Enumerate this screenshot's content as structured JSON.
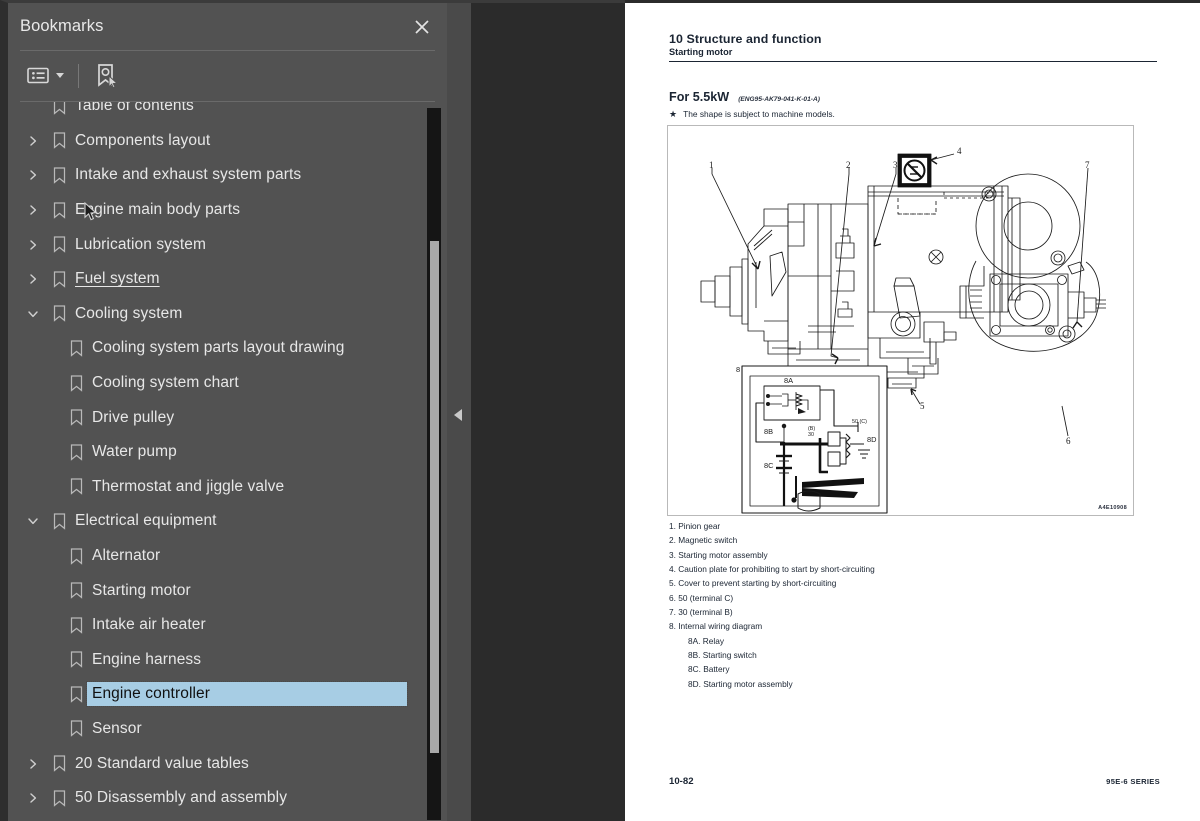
{
  "panel": {
    "title": "Bookmarks",
    "close_icon": "close-icon",
    "toolbar": {
      "options_icon": "list-options-icon",
      "find_bookmark_icon": "bookmark-pointer-icon"
    }
  },
  "tree": [
    {
      "label": "Table of contents",
      "depth": 0,
      "twisty": "none",
      "selected": false,
      "underline": false
    },
    {
      "label": "Components layout",
      "depth": 0,
      "twisty": "collapsed",
      "selected": false,
      "underline": false
    },
    {
      "label": "Intake and exhaust system parts",
      "depth": 0,
      "twisty": "collapsed",
      "selected": false,
      "underline": false
    },
    {
      "label": "Engine main body parts",
      "depth": 0,
      "twisty": "collapsed",
      "selected": false,
      "underline": false
    },
    {
      "label": "Lubrication system",
      "depth": 0,
      "twisty": "collapsed",
      "selected": false,
      "underline": false
    },
    {
      "label": "Fuel system ",
      "depth": 0,
      "twisty": "collapsed",
      "selected": false,
      "underline": true
    },
    {
      "label": "Cooling system",
      "depth": 0,
      "twisty": "expanded",
      "selected": false,
      "underline": false
    },
    {
      "label": "Cooling system parts layout drawing",
      "depth": 1,
      "twisty": "none",
      "selected": false,
      "underline": false
    },
    {
      "label": "Cooling system chart",
      "depth": 1,
      "twisty": "none",
      "selected": false,
      "underline": false
    },
    {
      "label": "Drive pulley",
      "depth": 1,
      "twisty": "none",
      "selected": false,
      "underline": false
    },
    {
      "label": "Water pump",
      "depth": 1,
      "twisty": "none",
      "selected": false,
      "underline": false
    },
    {
      "label": "Thermostat and jiggle valve",
      "depth": 1,
      "twisty": "none",
      "selected": false,
      "underline": false
    },
    {
      "label": "Electrical equipment",
      "depth": 0,
      "twisty": "expanded",
      "selected": false,
      "underline": false
    },
    {
      "label": "Alternator",
      "depth": 1,
      "twisty": "none",
      "selected": false,
      "underline": false
    },
    {
      "label": "Starting motor",
      "depth": 1,
      "twisty": "none",
      "selected": false,
      "underline": false
    },
    {
      "label": "Intake air heater",
      "depth": 1,
      "twisty": "none",
      "selected": false,
      "underline": false
    },
    {
      "label": "Engine harness",
      "depth": 1,
      "twisty": "none",
      "selected": false,
      "underline": false
    },
    {
      "label": "Engine controller",
      "depth": 1,
      "twisty": "none",
      "selected": true,
      "underline": false
    },
    {
      "label": "Sensor",
      "depth": 1,
      "twisty": "none",
      "selected": false,
      "underline": false
    },
    {
      "label": "20 Standard value tables",
      "depth": 0,
      "twisty": "collapsed",
      "selected": false,
      "underline": false
    },
    {
      "label": "50 Disassembly and assembly",
      "depth": 0,
      "twisty": "collapsed",
      "selected": false,
      "underline": false
    }
  ],
  "document": {
    "chapter": "10 Structure and function",
    "section": "Starting motor",
    "subtitle": "For 5.5kW",
    "subtitle_code": "(ENG95-AK79-041-K-01-A)",
    "note_star": "★",
    "note": "The shape is subject to machine models.",
    "figure_code": "A4E10908",
    "parts": [
      {
        "text": "1. Pinion gear",
        "sub": false
      },
      {
        "text": "2. Magnetic switch",
        "sub": false
      },
      {
        "text": "3. Starting motor assembly",
        "sub": false
      },
      {
        "text": "4. Caution plate for prohibiting to start by short-circuiting",
        "sub": false
      },
      {
        "text": "5. Cover to prevent starting by short-circuiting",
        "sub": false
      },
      {
        "text": "6. 50 (terminal C)",
        "sub": false
      },
      {
        "text": "7. 30 (terminal B)",
        "sub": false
      },
      {
        "text": "8. Internal wiring diagram",
        "sub": false
      },
      {
        "text": "8A. Relay",
        "sub": true
      },
      {
        "text": "8B. Starting switch",
        "sub": true
      },
      {
        "text": "8C. Battery",
        "sub": true
      },
      {
        "text": "8D. Starting motor assembly",
        "sub": true
      }
    ],
    "page_number": "10-82",
    "series": "95E-6 SERIES",
    "figure_callouts": [
      "1",
      "2",
      "3",
      "4",
      "5",
      "6",
      "7",
      "8",
      "8A",
      "8B",
      "8C",
      "8D"
    ]
  },
  "colors": {
    "panel_bg": "#525252",
    "gutter_bg": "#2b2b2b",
    "selection": "#a7cde4",
    "page_bg": "#ffffff",
    "text": "#e7e7e7",
    "scrollbar_thumb": "#a9a9a9"
  }
}
